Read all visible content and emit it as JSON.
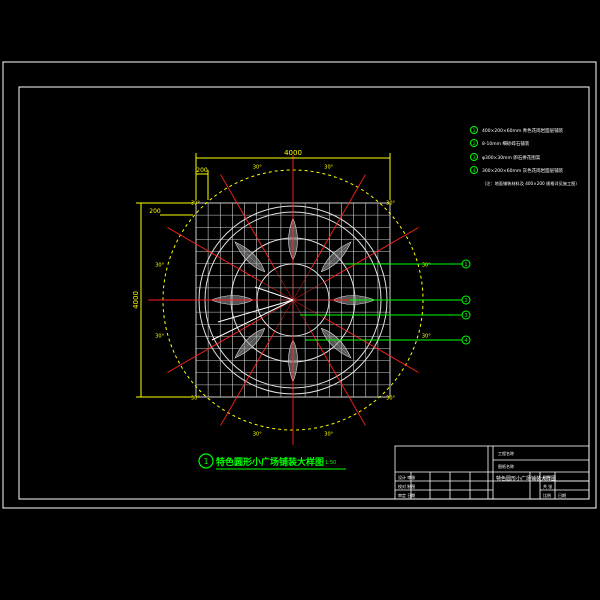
{
  "drawing": {
    "dimensions": {
      "overall_width": "4000",
      "overall_height": "4000",
      "corner_offset_x": "200",
      "corner_offset_y": "200"
    },
    "angle_labels": [
      "30°",
      "30°",
      "30°",
      "30°",
      "30°",
      "30°",
      "30°",
      "30°",
      "30°",
      "30°",
      "30°",
      "30°"
    ],
    "legend_notes": [
      "400×200×60mm 青色花岗岩面层铺装",
      "8-10mm 细砂碎石铺装",
      "φ300×30mm 卵石拼花图案",
      "300×200×60mm 灰色花岗岩面层铺装",
      "（注：地面铺装材料及 400×200 规格详见施工图）"
    ],
    "callout_numbers": [
      "1",
      "2",
      "3",
      "4"
    ],
    "plan_title": {
      "number": "1",
      "text": "特色圆形小广场铺装大样图",
      "scale": "1:50"
    },
    "colors": {
      "frame": "#ffffff",
      "grid": "#cfcfcf",
      "outer_circle": "#ffff00",
      "radial_lines": "#ff2020",
      "leader_lines": "#00ff00",
      "dimensions": "#ffff00",
      "title_text": "#00ff00"
    }
  },
  "title_block": {
    "project_label": "工程名称",
    "drawing_label": "图纸名称",
    "designer_row": "设计 审核",
    "check_row": "校对 制图",
    "approve_row": "审定 日期",
    "drawing_name": "特色圆形小广场铺装大样图",
    "drawing_no_label": "图号",
    "sheet_label": "共 张",
    "scale_label": "比例",
    "date_label": "日期"
  }
}
